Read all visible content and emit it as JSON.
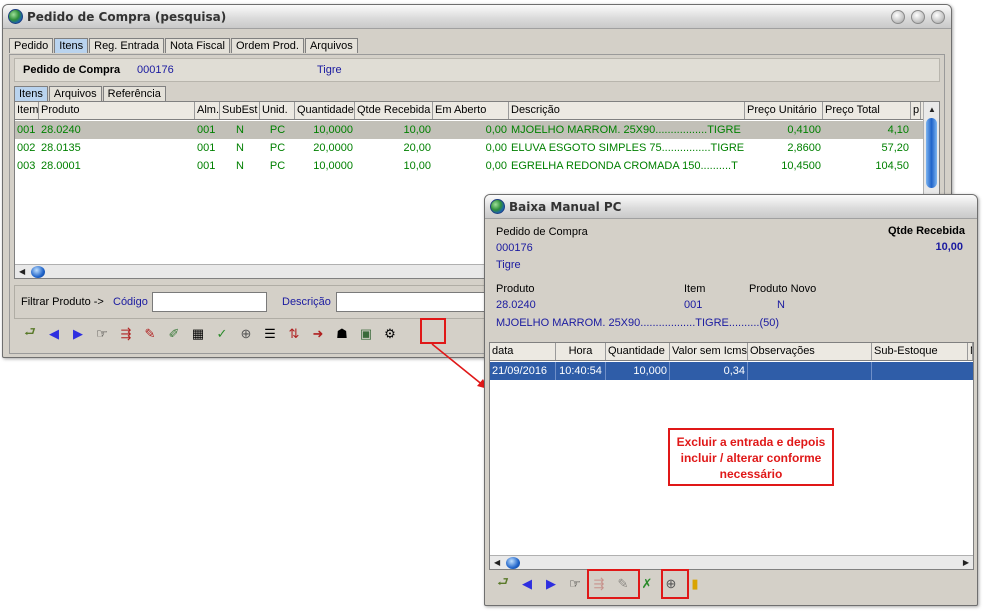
{
  "main_window": {
    "title": "Pedido de Compra  (pesquisa)",
    "tabs": [
      "Pedido",
      "Itens",
      "Reg. Entrada",
      "Nota Fiscal",
      "Ordem Prod.",
      "Arquivos"
    ],
    "active_tab": "Itens",
    "header": {
      "label": "Pedido de Compra",
      "number": "000176",
      "supplier": "Tigre"
    },
    "subtabs": [
      "Itens",
      "Arquivos",
      "Referência"
    ],
    "active_subtab": "Itens",
    "columns": [
      "Item",
      "Produto",
      "Alm.",
      "SubEst",
      "Unid.",
      "Quantidade",
      "Qtde Recebida",
      "Em Aberto",
      "Descrição",
      "Preço Unitário",
      "Preço Total",
      "p"
    ],
    "rows": [
      [
        "001",
        "28.0240",
        "001",
        "N",
        "PC",
        "10,0000",
        "10,00",
        "0,00",
        "MJOELHO MARROM. 25X90.................TIGRE",
        "0,4100",
        "4,10"
      ],
      [
        "002",
        "28.0135",
        "001",
        "N",
        "PC",
        "20,0000",
        "20,00",
        "0,00",
        "ELUVA ESGOTO SIMPLES  75................TIGRE",
        "2,8600",
        "57,20"
      ],
      [
        "003",
        "28.0001",
        "001",
        "N",
        "PC",
        "10,0000",
        "10,00",
        "0,00",
        "EGRELHA  REDONDA CROMADA 150..........T",
        "10,4500",
        "104,50"
      ]
    ],
    "filter": {
      "label": "Filtrar Produto ->",
      "code_label": "Código",
      "code_value": "",
      "desc_label": "Descrição",
      "desc_value": ""
    },
    "toolbar": [
      "exit-icon",
      "prev-arrow-icon",
      "next-arrow-icon",
      "hand-point-icon",
      "insert-icon",
      "edit-doc-icon",
      "pencil-doc-icon",
      "calc-doc-icon",
      "check-doc-icon",
      "magnifier-icon",
      "list-doc-icon",
      "transfer-icon",
      "export-doc-icon",
      "people-icon",
      "manual-receipt-icon",
      "gears-icon"
    ]
  },
  "baixa_window": {
    "title": "Baixa Manual PC",
    "pedido_label": "Pedido de Compra",
    "pedido_number": "000176",
    "supplier": "Tigre",
    "qtde_label": "Qtde Recebida",
    "qtde_value": "10,00",
    "produto_label": "Produto",
    "produto_value": "28.0240",
    "item_label": "Item",
    "item_value": "001",
    "produto_novo_label": "Produto Novo",
    "produto_novo_value": "N",
    "descricao": "MJOELHO MARROM. 25X90..................TIGRE..........(50)",
    "columns": [
      "data",
      "Hora",
      "Quantidade",
      "Valor sem Icms",
      "Observações",
      "Sub-Estoque",
      "N"
    ],
    "rows": [
      [
        "21/09/2016",
        "10:40:54",
        "10,000",
        "0,34",
        "",
        ""
      ]
    ],
    "toolbar": [
      "exit-icon",
      "prev-arrow-icon",
      "next-arrow-icon",
      "hand-point-icon",
      "insert-icon",
      "edit-doc-icon",
      "delete-doc-icon",
      "magnifier-icon",
      "door-exit-icon"
    ]
  },
  "annotation": {
    "text": "Excluir a entrada e depois incluir / alterar conforme necessário",
    "color": "#e01818"
  }
}
